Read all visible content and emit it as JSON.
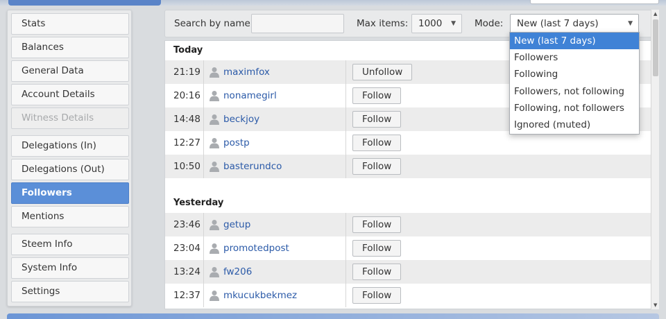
{
  "sidebar": {
    "items": [
      {
        "label": "Stats",
        "state": "normal"
      },
      {
        "label": "Balances",
        "state": "normal"
      },
      {
        "label": "General Data",
        "state": "normal"
      },
      {
        "label": "Account Details",
        "state": "normal"
      },
      {
        "label": "Witness Details",
        "state": "disabled"
      },
      {
        "label": "Delegations (In)",
        "state": "normal"
      },
      {
        "label": "Delegations (Out)",
        "state": "normal"
      },
      {
        "label": "Followers",
        "state": "active"
      },
      {
        "label": "Mentions",
        "state": "normal"
      },
      {
        "label": "Steem Info",
        "state": "normal"
      },
      {
        "label": "System Info",
        "state": "normal"
      },
      {
        "label": "Settings",
        "state": "normal"
      }
    ]
  },
  "toolbar": {
    "search_label": "Search by name:",
    "search_value": "",
    "max_items_label": "Max items:",
    "max_items_value": "1000",
    "mode_label": "Mode:",
    "mode_value": "New (last 7 days)"
  },
  "mode_dropdown": {
    "options": [
      "New (last 7 days)",
      "Followers",
      "Following",
      "Followers, not following",
      "Following, not followers",
      "Ignored (muted)"
    ],
    "selected_index": 0
  },
  "groups": [
    {
      "title": "Today",
      "rows": [
        {
          "time": "21:19",
          "name": "maximfox",
          "action": "Unfollow"
        },
        {
          "time": "20:16",
          "name": "nonamegirl",
          "action": "Follow"
        },
        {
          "time": "14:48",
          "name": "beckjoy",
          "action": "Follow"
        },
        {
          "time": "12:27",
          "name": "postp",
          "action": "Follow"
        },
        {
          "time": "10:50",
          "name": "basterundco",
          "action": "Follow"
        }
      ]
    },
    {
      "title": "Yesterday",
      "rows": [
        {
          "time": "23:46",
          "name": "getup",
          "action": "Follow"
        },
        {
          "time": "23:04",
          "name": "promotedpost",
          "action": "Follow"
        },
        {
          "time": "13:24",
          "name": "fw206",
          "action": "Follow"
        },
        {
          "time": "12:37",
          "name": "mkucukbekmez",
          "action": "Follow"
        }
      ]
    }
  ],
  "colors": {
    "accent": "#5b8fd8",
    "link": "#2b5aa8",
    "dropdown_selected": "#3f82d6"
  }
}
